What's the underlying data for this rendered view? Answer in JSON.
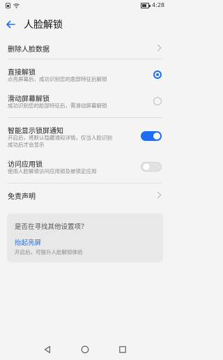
{
  "status": {
    "time": "4:28"
  },
  "header": {
    "title": "人脸解锁"
  },
  "rows": {
    "delete_face": {
      "title": "删除人脸数据"
    },
    "direct_unlock": {
      "title": "直接解锁",
      "subtitle": "点亮屏幕后，成功识别您的面部特征后解锁",
      "selected": true
    },
    "slide_unlock": {
      "title": "滑动屏幕解锁",
      "subtitle": "成功识别您的脸部特征后，需滑动屏幕解锁",
      "selected": false
    },
    "smart_notify": {
      "title": "智能显示锁屏通知",
      "subtitle_line1": "开启后，将默认隐藏通知详情，仅当人脸识别",
      "subtitle_line2": "成功后才会显示",
      "enabled": true
    },
    "app_lock": {
      "title": "访问应用锁",
      "subtitle": "使用人脸解锁访问应用锁及被锁定应用",
      "enabled": false
    },
    "disclaimer": {
      "title": "免责声明"
    }
  },
  "suggest": {
    "question": "是否在寻找其他设置项？",
    "link": "抬起亮屏",
    "desc": "开启后，可提升人脸解锁体验"
  },
  "colors": {
    "accent": "#1e6ef2"
  },
  "nav": {
    "icons": [
      "back-triangle-icon",
      "home-circle-icon",
      "recents-square-icon"
    ]
  }
}
